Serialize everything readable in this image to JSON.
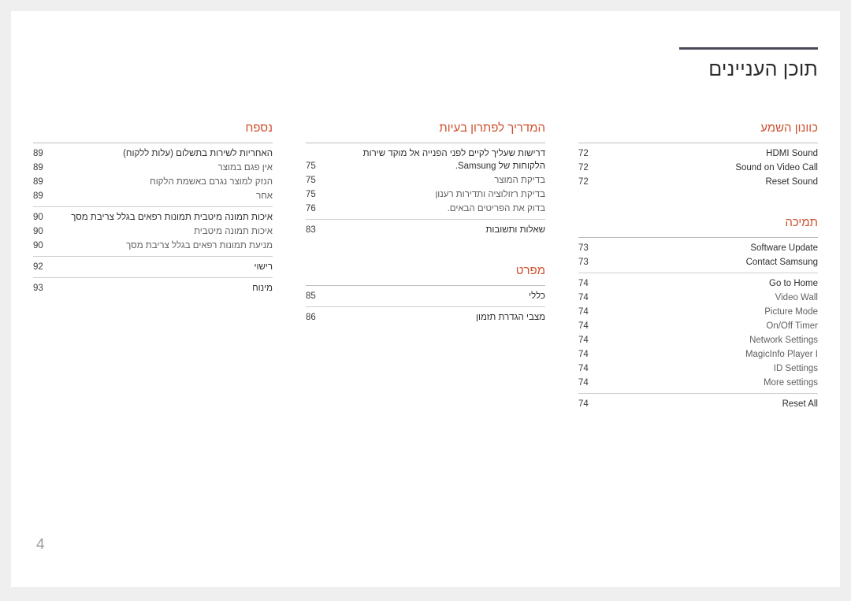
{
  "document": {
    "title": "תוכן העניינים",
    "page_number": "4",
    "accent_color": "#cf4f2d",
    "rule_color": "#4a4a58"
  },
  "columns": [
    {
      "name": "column-right",
      "sections": [
        {
          "heading": "כוונון השמע",
          "groups": [
            {
              "entries": [
                {
                  "label": "HDMI Sound",
                  "page": "72",
                  "dir": "ltr",
                  "level": "top"
                },
                {
                  "label": "Sound on Video Call",
                  "page": "72",
                  "dir": "ltr",
                  "level": "top"
                },
                {
                  "label": "Reset Sound",
                  "page": "72",
                  "dir": "ltr",
                  "level": "top"
                }
              ]
            }
          ]
        },
        {
          "heading": "תמיכה",
          "groups": [
            {
              "entries": [
                {
                  "label": "Software Update",
                  "page": "73",
                  "dir": "ltr",
                  "level": "top"
                },
                {
                  "label": "Contact Samsung",
                  "page": "73",
                  "dir": "ltr",
                  "level": "top"
                }
              ]
            },
            {
              "entries": [
                {
                  "label": "Go to Home",
                  "page": "74",
                  "dir": "ltr",
                  "level": "top"
                },
                {
                  "label": "Video Wall",
                  "page": "74",
                  "dir": "ltr",
                  "level": "sub"
                },
                {
                  "label": "Picture Mode",
                  "page": "74",
                  "dir": "ltr",
                  "level": "sub"
                },
                {
                  "label": "On/Off Timer",
                  "page": "74",
                  "dir": "ltr",
                  "level": "sub"
                },
                {
                  "label": "Network Settings",
                  "page": "74",
                  "dir": "ltr",
                  "level": "sub"
                },
                {
                  "label": "MagicInfo Player I",
                  "page": "74",
                  "dir": "ltr",
                  "level": "sub"
                },
                {
                  "label": "ID Settings",
                  "page": "74",
                  "dir": "ltr",
                  "level": "sub"
                },
                {
                  "label": "More settings",
                  "page": "74",
                  "dir": "ltr",
                  "level": "sub"
                }
              ]
            },
            {
              "entries": [
                {
                  "label": "Reset All",
                  "page": "74",
                  "dir": "ltr",
                  "level": "top"
                }
              ]
            }
          ]
        }
      ]
    },
    {
      "name": "column-middle",
      "sections": [
        {
          "heading": "המדריך לפתרון בעיות",
          "groups": [
            {
              "entries": [
                {
                  "label": "דרישות שעליך לקיים לפני הפנייה אל מוקד שירות הלקוחות של Samsung.",
                  "page": "75",
                  "dir": "rtl",
                  "level": "top",
                  "wrap": true
                },
                {
                  "label": "בדיקת המוצר",
                  "page": "75",
                  "dir": "rtl",
                  "level": "sub"
                },
                {
                  "label": "בדיקת רזולוציה ותדירות רענון",
                  "page": "75",
                  "dir": "rtl",
                  "level": "sub"
                },
                {
                  "label": "בדוק את הפריטים הבאים.",
                  "page": "76",
                  "dir": "rtl",
                  "level": "sub"
                }
              ]
            },
            {
              "entries": [
                {
                  "label": "שאלות ותשובות",
                  "page": "83",
                  "dir": "rtl",
                  "level": "top"
                }
              ]
            }
          ]
        },
        {
          "heading": "מפרט",
          "groups": [
            {
              "entries": [
                {
                  "label": "כללי",
                  "page": "85",
                  "dir": "rtl",
                  "level": "top"
                }
              ]
            },
            {
              "entries": [
                {
                  "label": "מצבי הגדרת תזמון",
                  "page": "86",
                  "dir": "rtl",
                  "level": "top"
                }
              ]
            }
          ]
        }
      ]
    },
    {
      "name": "column-left",
      "sections": [
        {
          "heading": "נספח",
          "groups": [
            {
              "entries": [
                {
                  "label": "האחריות לשירות בתשלום (עלות ללקוח)",
                  "page": "89",
                  "dir": "rtl",
                  "level": "top"
                },
                {
                  "label": "אין פגם במוצר",
                  "page": "89",
                  "dir": "rtl",
                  "level": "sub"
                },
                {
                  "label": "הנזק למוצר נגרם באשמת הלקוח",
                  "page": "89",
                  "dir": "rtl",
                  "level": "sub"
                },
                {
                  "label": "אחר",
                  "page": "89",
                  "dir": "rtl",
                  "level": "sub"
                }
              ]
            },
            {
              "entries": [
                {
                  "label": "איכות תמונה מיטבית תמונות רפאים בגלל צריבת מסך",
                  "page": "90",
                  "dir": "rtl",
                  "level": "top",
                  "wrap": true
                },
                {
                  "label": "איכות תמונה מיטבית",
                  "page": "90",
                  "dir": "rtl",
                  "level": "sub"
                },
                {
                  "label": "מניעת תמונות רפאים בגלל צריבת מסך",
                  "page": "90",
                  "dir": "rtl",
                  "level": "sub"
                }
              ]
            },
            {
              "entries": [
                {
                  "label": "רישוי",
                  "page": "92",
                  "dir": "rtl",
                  "level": "top"
                }
              ]
            },
            {
              "entries": [
                {
                  "label": "מינוח",
                  "page": "93",
                  "dir": "rtl",
                  "level": "top"
                }
              ]
            }
          ]
        }
      ]
    }
  ]
}
